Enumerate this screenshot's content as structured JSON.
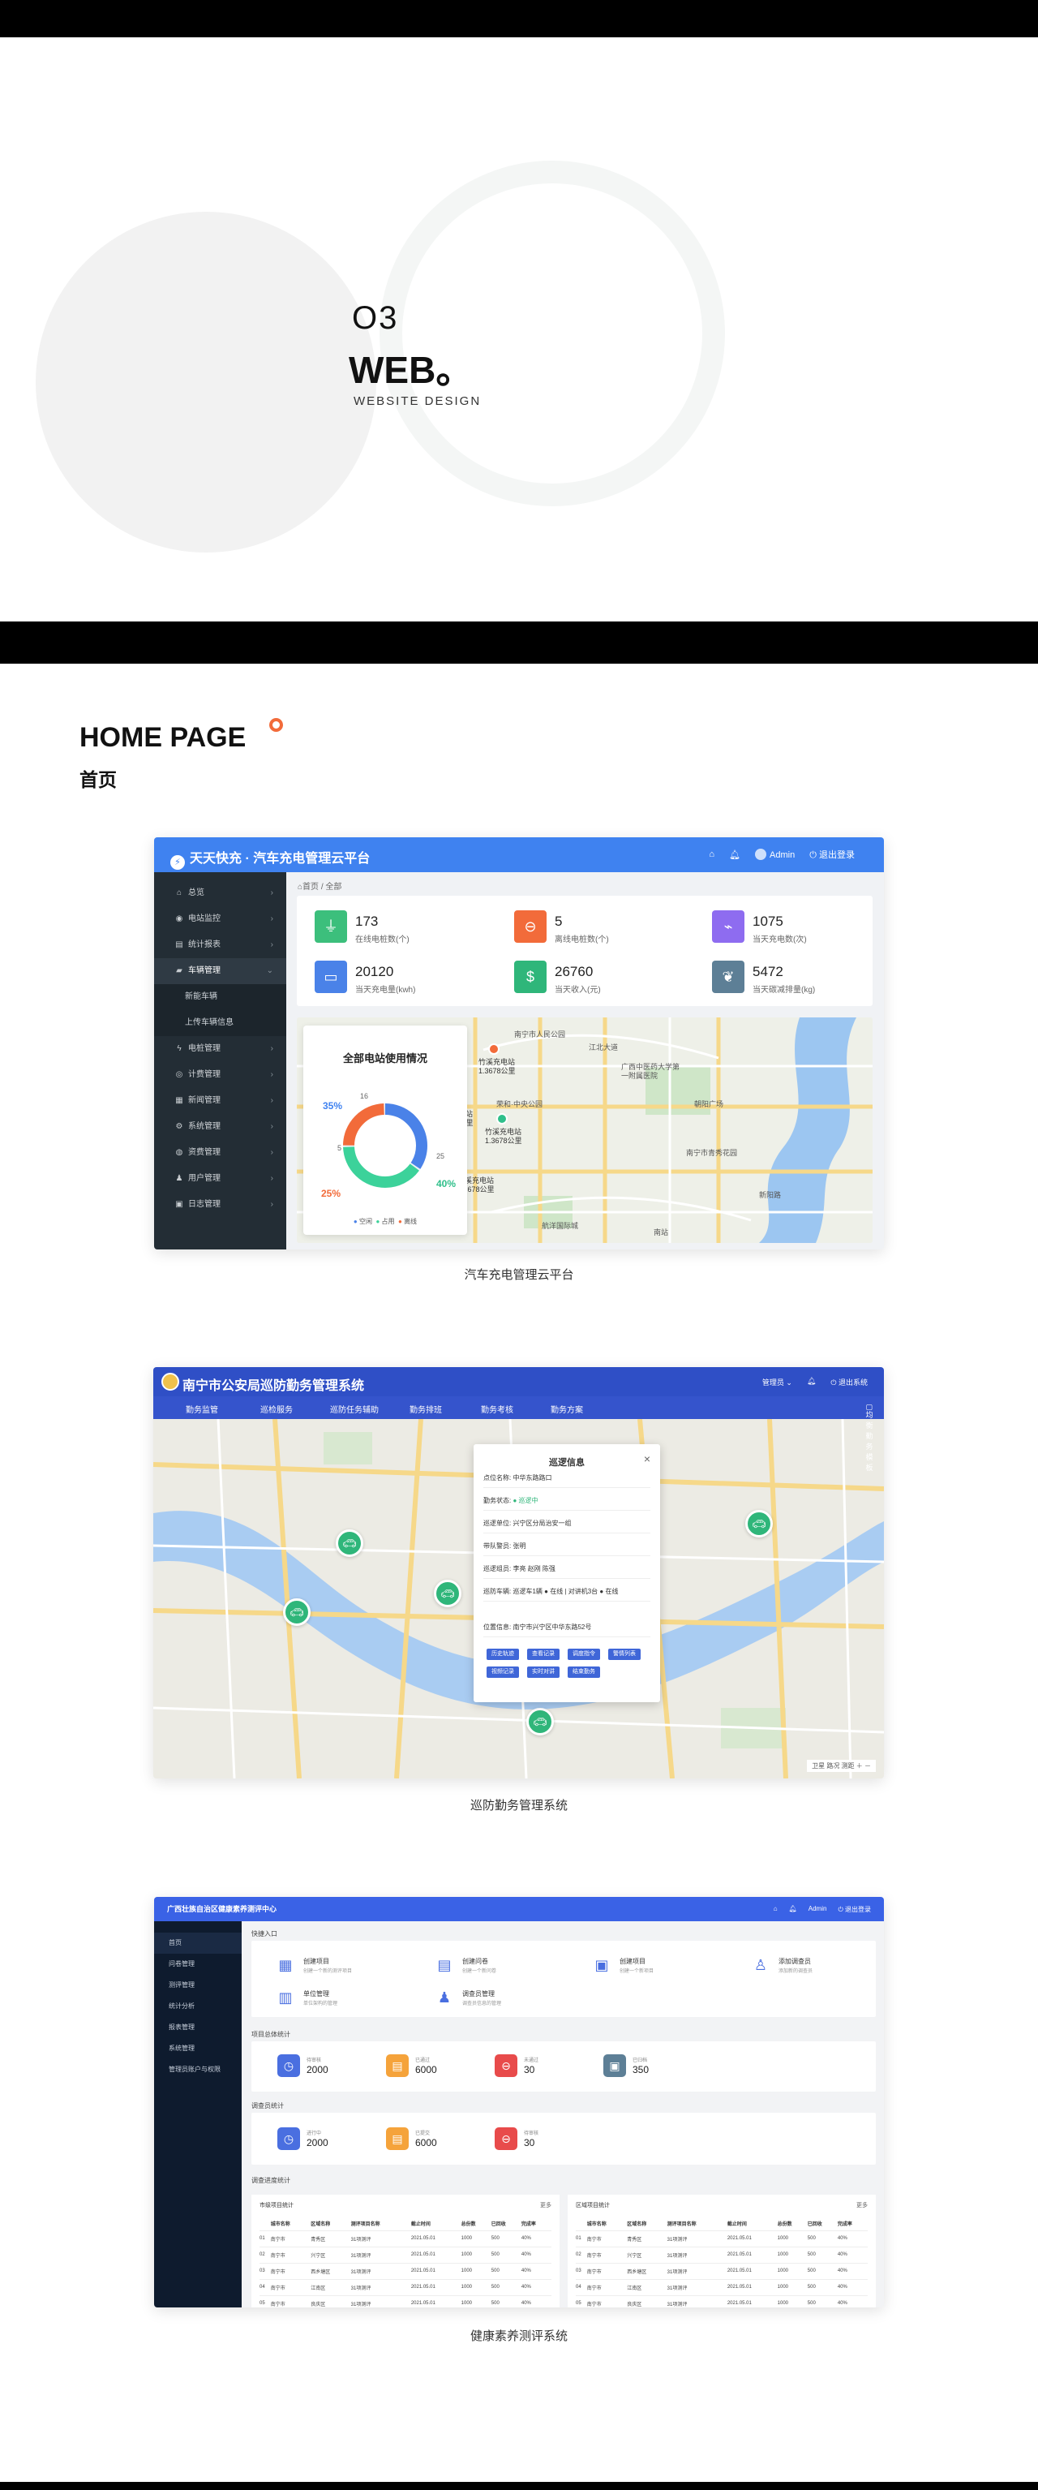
{
  "hero": {
    "number": "O3",
    "title": "WEB。",
    "subtitle": "WEBSITE DESIGN"
  },
  "section": {
    "title": "HOME PAGE",
    "subtitle": "首页"
  },
  "captions": [
    "汽车充电管理云平台",
    "巡防勤务管理系统",
    "健康素养测评系统"
  ],
  "colors": {
    "accent1": "#3f82f0",
    "accent2": "#2f4fc6",
    "accent3": "#3a62e6",
    "sidebar": "#232d35"
  },
  "screen1": {
    "brand": "天天快充 · 汽车充电管理云平台",
    "user": "Admin",
    "logout": "退出登录",
    "breadcrumb": "首页 / 全部",
    "nav": [
      {
        "label": "总览",
        "icon": "home-icon"
      },
      {
        "label": "电站监控",
        "icon": "location-icon"
      },
      {
        "label": "统计报表",
        "icon": "chart-icon"
      },
      {
        "label": "车辆管理",
        "icon": "car-icon",
        "active": true
      },
      {
        "label": "电桩管理",
        "icon": "bolt-icon"
      },
      {
        "label": "计费管理",
        "icon": "billing-icon"
      },
      {
        "label": "新闻管理",
        "icon": "news-icon"
      },
      {
        "label": "系统管理",
        "icon": "settings-icon"
      },
      {
        "label": "资费管理",
        "icon": "fee-icon"
      },
      {
        "label": "用户管理",
        "icon": "user-icon"
      },
      {
        "label": "日志管理",
        "icon": "log-icon"
      }
    ],
    "subnav": [
      "新能车辆",
      "上传车辆信息"
    ],
    "stats": [
      {
        "value": "173",
        "label": "在线电桩数(个)",
        "color": "#3cbf7c",
        "icon": "plug-icon"
      },
      {
        "value": "5",
        "label": "离线电桩数(个)",
        "color": "#f26b3a",
        "icon": "minus-icon"
      },
      {
        "value": "1075",
        "label": "当天充电数(次)",
        "color": "#8e6cf0",
        "icon": "charger-icon"
      },
      {
        "value": "20120",
        "label": "当天充电量(kwh)",
        "color": "#4a82e8",
        "icon": "battery-icon"
      },
      {
        "value": "26760",
        "label": "当天收入(元)",
        "color": "#2fb67a",
        "icon": "money-icon"
      },
      {
        "value": "5472",
        "label": "当天碳减排量(kg)",
        "color": "#5d7f96",
        "icon": "leaf-icon"
      }
    ],
    "donut": {
      "title": "全部电站使用情况",
      "inner_left": "5",
      "inner_top": "16",
      "inner_right": "25",
      "pct_top": "35%",
      "pct_left": "25%",
      "pct_right": "40%",
      "legend": [
        "空闲",
        "占用",
        "离线"
      ]
    },
    "chart_data": {
      "type": "pie",
      "title": "全部电站使用情况",
      "categories": [
        "空闲",
        "占用",
        "离线"
      ],
      "values": [
        35,
        40,
        25
      ],
      "colors": [
        "#4a82e8",
        "#3cd29a",
        "#f26b3a"
      ]
    },
    "map_labels": [
      "南宁市人民公园",
      "广西中医药大学第一附属医院",
      "朝阳广场",
      "江北大道",
      "新阳路",
      "南宁市青秀花园",
      "航洋国际城",
      "荣和·中央公园",
      "南站"
    ],
    "pins": [
      {
        "name": "竹溪充电站",
        "distance": "1.3678公里"
      },
      {
        "name": "竹溪充电站",
        "distance": "1.3678公里"
      },
      {
        "name": "竹溪充电站",
        "distance": "1.3678公里"
      },
      {
        "name": "竹溪充电站",
        "distance": "1.3678公里"
      }
    ]
  },
  "screen2": {
    "brand": "南宁市公安局巡防勤务管理系统",
    "user": "管理员",
    "logout": "退出系统",
    "nav": [
      "勤务监管",
      "巡检服务",
      "巡防任务辅助",
      "勤务排班",
      "勤务考核",
      "勤务方案"
    ],
    "nav_right": "均衡勤务模板",
    "popup": {
      "title": "巡逻信息",
      "close": "×",
      "rows": [
        {
          "k": "点位名称:",
          "v": "中华东路路口"
        },
        {
          "k": "勤务状态:",
          "v": "● 巡逻中"
        },
        {
          "k": "巡逻单位:",
          "v": "兴宁区分局治安一组"
        },
        {
          "k": "带队警员:",
          "v": "张明"
        },
        {
          "k": "巡逻组员:",
          "v": "李亮  赵刚  陈强"
        },
        {
          "k": "巡防车辆:",
          "v": "巡逻车1辆 ● 在线 | 对讲机3台 ● 在线"
        },
        {
          "k": "位置信息:",
          "v": "南宁市兴宁区中华东路52号"
        }
      ],
      "buttons": [
        "历史轨迹",
        "查看记录",
        "调度指令",
        "警情列表",
        "视频记录",
        "实时对讲",
        "结束勤务"
      ]
    },
    "controls": "卫星  路况  测距  ＋  －"
  },
  "screen3": {
    "brand": "广西壮族自治区健康素养测评中心",
    "user": "Admin",
    "logout": "退出登录",
    "nav": [
      "首页",
      "问卷管理",
      "测评管理",
      "统计分析",
      "报表管理",
      "系统管理",
      "管理员账户与权限"
    ],
    "h_quick": "快捷入口",
    "quick": [
      {
        "title": "创建项目",
        "desc": "创建一个新的测评项目",
        "icon": "calendar-icon"
      },
      {
        "title": "创建问卷",
        "desc": "创建一个新问卷",
        "icon": "form-icon"
      },
      {
        "title": "创建项目",
        "desc": "创建一个新项目",
        "icon": "clipboard-icon"
      },
      {
        "title": "添加调查员",
        "desc": "添加新的调查员",
        "icon": "user-plus-icon"
      },
      {
        "title": "单位管理",
        "desc": "单位架构的管理",
        "icon": "org-icon"
      },
      {
        "title": "调查员管理",
        "desc": "调查员信息的管理",
        "icon": "people-icon"
      }
    ],
    "h_project": "项目总体统计",
    "project_kpis": [
      {
        "label": "待审核",
        "value": "2000",
        "color": "#4a6fe0"
      },
      {
        "label": "已通过",
        "value": "6000",
        "color": "#f5a33b"
      },
      {
        "label": "未通过",
        "value": "30",
        "color": "#e84b4b"
      },
      {
        "label": "已归档",
        "value": "350",
        "color": "#5d7f96"
      }
    ],
    "h_survey": "调查员统计",
    "survey_kpis": [
      {
        "label": "进行中",
        "value": "2000",
        "color": "#4a6fe0"
      },
      {
        "label": "已提交",
        "value": "6000",
        "color": "#f5a33b"
      },
      {
        "label": "待审核",
        "value": "30",
        "color": "#e84b4b"
      }
    ],
    "h_tables": "调查进度统计",
    "tables": [
      {
        "title": "市级项目统计",
        "more": "更多",
        "headers": [
          "",
          "城市名称",
          "区域名称",
          "测评项目名称",
          "截止时间",
          "总份数",
          "已回收",
          "完成率"
        ],
        "rows": [
          [
            "01",
            "南宁市",
            "青秀区",
            "31项测评",
            "2021.05.01",
            "1000",
            "500",
            "40%"
          ],
          [
            "02",
            "南宁市",
            "兴宁区",
            "31项测评",
            "2021.05.01",
            "1000",
            "500",
            "40%"
          ],
          [
            "03",
            "南宁市",
            "西乡塘区",
            "31项测评",
            "2021.05.01",
            "1000",
            "500",
            "40%"
          ],
          [
            "04",
            "南宁市",
            "江南区",
            "31项测评",
            "2021.05.01",
            "1000",
            "500",
            "40%"
          ],
          [
            "05",
            "南宁市",
            "良庆区",
            "31项测评",
            "2021.05.01",
            "1000",
            "500",
            "40%"
          ]
        ]
      },
      {
        "title": "区域项目统计",
        "more": "更多",
        "headers": [
          "",
          "城市名称",
          "区域名称",
          "测评项目名称",
          "截止时间",
          "总份数",
          "已回收",
          "完成率"
        ],
        "rows": [
          [
            "01",
            "南宁市",
            "青秀区",
            "31项测评",
            "2021.05.01",
            "1000",
            "500",
            "40%"
          ],
          [
            "02",
            "南宁市",
            "兴宁区",
            "31项测评",
            "2021.05.01",
            "1000",
            "500",
            "40%"
          ],
          [
            "03",
            "南宁市",
            "西乡塘区",
            "31项测评",
            "2021.05.01",
            "1000",
            "500",
            "40%"
          ],
          [
            "04",
            "南宁市",
            "江南区",
            "31项测评",
            "2021.05.01",
            "1000",
            "500",
            "40%"
          ],
          [
            "05",
            "南宁市",
            "良庆区",
            "31项测评",
            "2021.05.01",
            "1000",
            "500",
            "40%"
          ]
        ]
      }
    ]
  }
}
